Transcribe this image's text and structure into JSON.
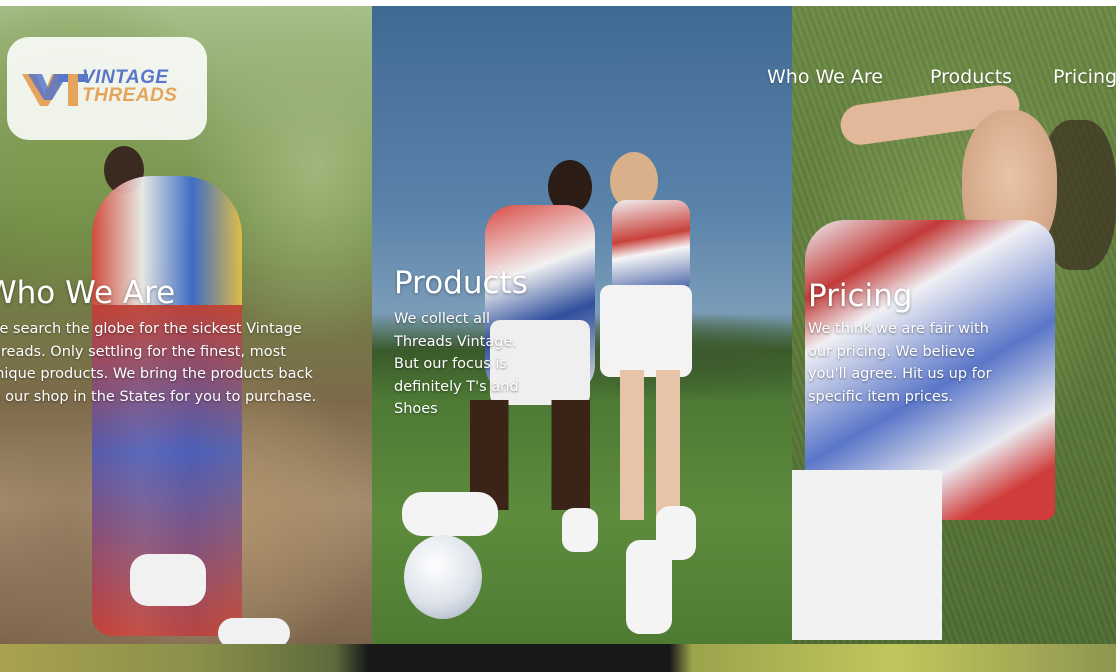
{
  "brand": {
    "logo_line1": "VINTAGE",
    "logo_line2": "THREADS",
    "logo_colors": {
      "blue": "#5877c9",
      "orange": "#e6a35b"
    }
  },
  "nav": {
    "items": [
      {
        "label": "Who We Are"
      },
      {
        "label": "Products"
      },
      {
        "label": "Pricing"
      }
    ]
  },
  "sections": {
    "who": {
      "title": "Who We Are",
      "body": "We search the globe for the sickest Vintage threads. Only settling for the finest, most unique products. We bring the products back to our shop in the States for you to purchase."
    },
    "products": {
      "title": "Products",
      "body": "We collect all Threads Vintage. But our focus is definitely T's and Shoes"
    },
    "pricing": {
      "title": "Pricing",
      "body": "We think we are fair with our pricing. We believe you'll agree. Hit us up for specific item prices."
    }
  }
}
